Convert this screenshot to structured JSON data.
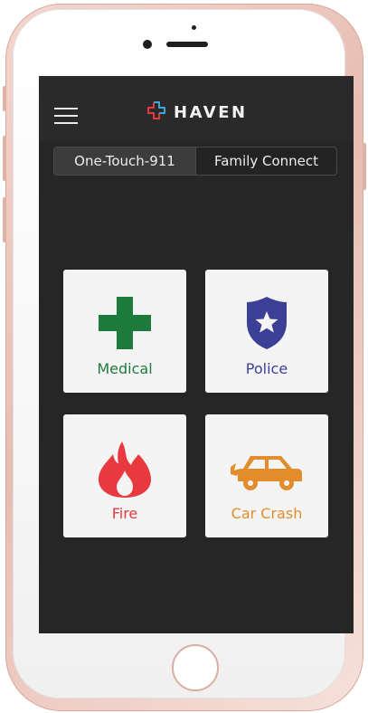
{
  "app": {
    "brand_name": "HAVEN"
  },
  "tabs": [
    {
      "label": "One-Touch-911",
      "selected": true
    },
    {
      "label": "Family Connect",
      "selected": false
    }
  ],
  "tiles": [
    {
      "label": "Medical",
      "icon": "medical-cross-icon",
      "color": "#1e7b3e"
    },
    {
      "label": "Police",
      "icon": "police-badge-icon",
      "color": "#3b3f96"
    },
    {
      "label": "Fire",
      "icon": "fire-icon",
      "color": "#e8393e"
    },
    {
      "label": "Car Crash",
      "icon": "car-icon",
      "color": "#e38c2c"
    }
  ],
  "colors": {
    "screen_background": "#262626",
    "tile_background": "#f4f4f4",
    "selected_segment": "#3c3c3c",
    "logo_red": "#e8393e",
    "logo_blue": "#3aa9e0"
  }
}
